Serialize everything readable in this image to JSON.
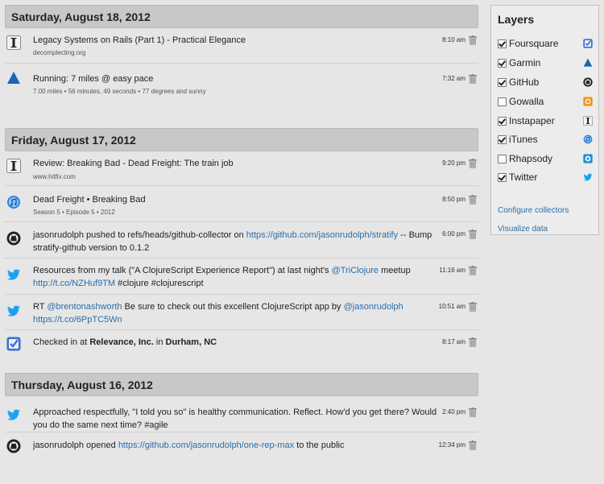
{
  "days": [
    {
      "date": "Saturday, August 18, 2012",
      "items": [
        {
          "icon": "instapaper-icon",
          "title": "Legacy Systems on Rails (Part 1) - Practical Elegance",
          "sub": "decomplecting.org",
          "time": "8:10 am"
        },
        {
          "icon": "garmin-icon",
          "title": "Running: 7 miles @ easy pace",
          "sub": "7.00 miles • 56 minutes, 49 seconds • 77 degrees and sunny",
          "time": "7:32 am"
        }
      ]
    },
    {
      "date": "Friday, August 17, 2012",
      "items": [
        {
          "icon": "instapaper-icon",
          "title": "Review: Breaking Bad - Dead Freight: The train job",
          "sub": "www.hitfix.com",
          "time": "9:20 pm"
        },
        {
          "icon": "itunes-icon",
          "title": "Dead Freight • Breaking Bad",
          "sub": "Season 5 • Episode 5 • 2012",
          "time": "8:50 pm"
        },
        {
          "icon": "github-icon",
          "title_pre": "jasonrudolph pushed to refs/heads/github-collector on ",
          "title_link": "https://github.com/jasonrudolph/stratify",
          "title_post": " -- Bump stratify-github version to 0.1.2",
          "time": "6:00 pm"
        },
        {
          "icon": "twitter-icon",
          "title_pre": "Resources from my talk (\"A ClojureScript Experience Report\") at last night's ",
          "title_link": "@TriClojure",
          "title_mid": " meetup",
          "title_link2": "http://t.co/NZHuf9TM",
          "title_post": " #clojure #clojurescript",
          "time": "11:16 am"
        },
        {
          "icon": "twitter-icon",
          "title_pre": "RT ",
          "title_link": "@brentonashworth",
          "title_mid": " Be sure to check out this excellent ClojureScript app by ",
          "title_link2": "@jasonrudolph",
          "title_link3": "https://t.co/6PpTC5Wn",
          "time": "10:51 am"
        },
        {
          "icon": "foursquare-icon",
          "title_pre": "Checked in at ",
          "title_bold": "Relevance, Inc.",
          "title_mid": " in ",
          "title_bold2": "Durham, NC",
          "time": "8:17 am"
        }
      ]
    },
    {
      "date": "Thursday, August 16, 2012",
      "items": [
        {
          "icon": "twitter-icon",
          "title": "Approached respectfully, \"I told you so\" is healthy communication. Reflect. How'd you get there? Would you do the same next time? #agile",
          "time": "2:40 pm"
        },
        {
          "icon": "github-icon",
          "title_pre": "jasonrudolph opened ",
          "title_link": "https://github.com/jasonrudolph/one-rep-max",
          "title_post": " to the public",
          "time": "12:34 pm"
        }
      ]
    }
  ],
  "layers": {
    "heading": "Layers",
    "items": [
      {
        "label": "Foursquare",
        "checked": true,
        "icon": "foursquare-icon"
      },
      {
        "label": "Garmin",
        "checked": true,
        "icon": "garmin-icon"
      },
      {
        "label": "GitHub",
        "checked": true,
        "icon": "github-icon"
      },
      {
        "label": "Gowalla",
        "checked": false,
        "icon": "gowalla-icon"
      },
      {
        "label": "Instapaper",
        "checked": true,
        "icon": "instapaper-icon"
      },
      {
        "label": "iTunes",
        "checked": true,
        "icon": "itunes-icon"
      },
      {
        "label": "Rhapsody",
        "checked": false,
        "icon": "rhapsody-icon"
      },
      {
        "label": "Twitter",
        "checked": true,
        "icon": "twitter-icon"
      }
    ],
    "configure_link": "Configure collectors",
    "visualize_link": "Visualize data"
  },
  "colors": {
    "link": "#2b6ea8",
    "twitter": "#1da1f2",
    "garmin": "#1a67b3",
    "foursquare": "#3b6fd1",
    "gowalla": "#f29220",
    "rhapsody": "#1f8fd6"
  }
}
